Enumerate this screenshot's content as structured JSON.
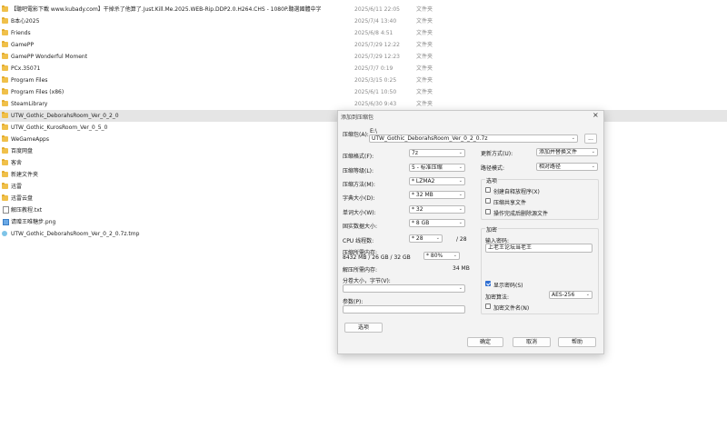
{
  "files": [
    {
      "name": "【聽吧電影下載 www.kubady.com】干掉杀了他算了.Just.Kill.Me.2025.WEB-Rip.DDP2.0.H264.CHS - 1080P.聽選國體中字",
      "date": "2025/6/11 22:05",
      "type": "文件夹",
      "icon": "folder-icon"
    },
    {
      "name": "B本心2025",
      "date": "2025/7/4 13:40",
      "type": "文件夹",
      "icon": "folder-icon"
    },
    {
      "name": "Friends",
      "date": "2025/6/8 4:51",
      "type": "文件夹",
      "icon": "folder-icon"
    },
    {
      "name": "GamePP",
      "date": "2025/7/29 12:22",
      "type": "文件夹",
      "icon": "folder-icon"
    },
    {
      "name": "GamePP Wonderful Moment",
      "date": "2025/7/29 12:23",
      "type": "文件夹",
      "icon": "folder-icon"
    },
    {
      "name": "PCx.35071",
      "date": "2025/7/7 0:19",
      "type": "文件夹",
      "icon": "folder-icon"
    },
    {
      "name": "Program Files",
      "date": "2025/3/15 0:25",
      "type": "文件夹",
      "icon": "folder-icon"
    },
    {
      "name": "Program Files (x86)",
      "date": "2025/6/1 10:50",
      "type": "文件夹",
      "icon": "folder-icon"
    },
    {
      "name": "SteamLibrary",
      "date": "2025/6/30 9:43",
      "type": "文件夹",
      "icon": "folder-icon"
    },
    {
      "name": "UTW_Gothic_DeborahsRoom_Ver_0_2_0",
      "date": "",
      "type": "",
      "icon": "folder-icon",
      "selected": true
    },
    {
      "name": "UTW_Gothic_KurosRoom_Ver_0_5_0",
      "date": "",
      "type": "",
      "icon": "folder-icon"
    },
    {
      "name": "WeGameApps",
      "date": "",
      "type": "",
      "icon": "folder-icon"
    },
    {
      "name": "百度网盘",
      "date": "",
      "type": "",
      "icon": "folder-icon"
    },
    {
      "name": "客舍",
      "date": "",
      "type": "",
      "icon": "folder-icon"
    },
    {
      "name": "新建文件夹",
      "date": "",
      "type": "",
      "icon": "folder-icon"
    },
    {
      "name": "迅雷",
      "date": "",
      "type": "",
      "icon": "folder-icon"
    },
    {
      "name": "迅雷云盘",
      "date": "",
      "type": "",
      "icon": "folder-icon"
    },
    {
      "name": "解压教程.txt",
      "date": "",
      "type": "",
      "icon": "txt-icon"
    },
    {
      "name": "请赠王唯糖步.png",
      "date": "",
      "type": "",
      "icon": "png-icon"
    },
    {
      "name": "UTW_Gothic_DeborahsRoom_Ver_0_2_0.7z.tmp",
      "date": "",
      "type": "",
      "icon": "tmp-icon"
    }
  ],
  "dialog": {
    "title": "添加到压缩包",
    "close": "×",
    "archive_label": "压缩包(A):",
    "archive_dir": "E:\\",
    "archive_name": "UTW_Gothic_DeborahsRoom_Ver_0_2_0.7z",
    "browse": "...",
    "format_label": "压缩格式(F):",
    "format_value": "7z",
    "level_label": "压缩等级(L):",
    "level_value": "5 - 标准压缩",
    "method_label": "压缩方法(M):",
    "method_value": "* LZMA2",
    "dict_label": "字典大小(D):",
    "dict_value": "* 32 MB",
    "word_label": "单词大小(W):",
    "word_value": "* 32",
    "solid_label": "固实数据大小:",
    "solid_value": "* 8 GB",
    "cpu_label": "CPU 线程数:",
    "cpu_value": "* 28",
    "cpu_max": "/ 28",
    "mem_label": "压缩所需内存:",
    "mem_detail": "8432 MB / 26 GB / 32 GB",
    "mem_value": "* 80%",
    "decomp_label": "解压所需内存:",
    "decomp_value": "34 MB",
    "split_label": "分卷大小，字节(V):",
    "split_value": "",
    "params_label": "参数(P):",
    "params_value": "",
    "options_button": "选项",
    "update_label": "更新方式(U):",
    "update_value": "添加并替换文件",
    "path_label": "路径模式:",
    "path_value": "相对路径",
    "options_group": "选项",
    "opt_sfx": "创建自释放程序(X)",
    "opt_shared": "压缩共享文件",
    "opt_delete": "操作完成后删除源文件",
    "encrypt_group": "加密",
    "pwd_label": "输入密码:",
    "pwd_value": "上老王论坛当老王",
    "show_pwd": "显示密码(S)",
    "enc_method_label": "加密算法:",
    "enc_method_value": "AES-256",
    "enc_names": "加密文件名(N)",
    "ok": "确定",
    "cancel": "取消",
    "help": "帮助"
  }
}
